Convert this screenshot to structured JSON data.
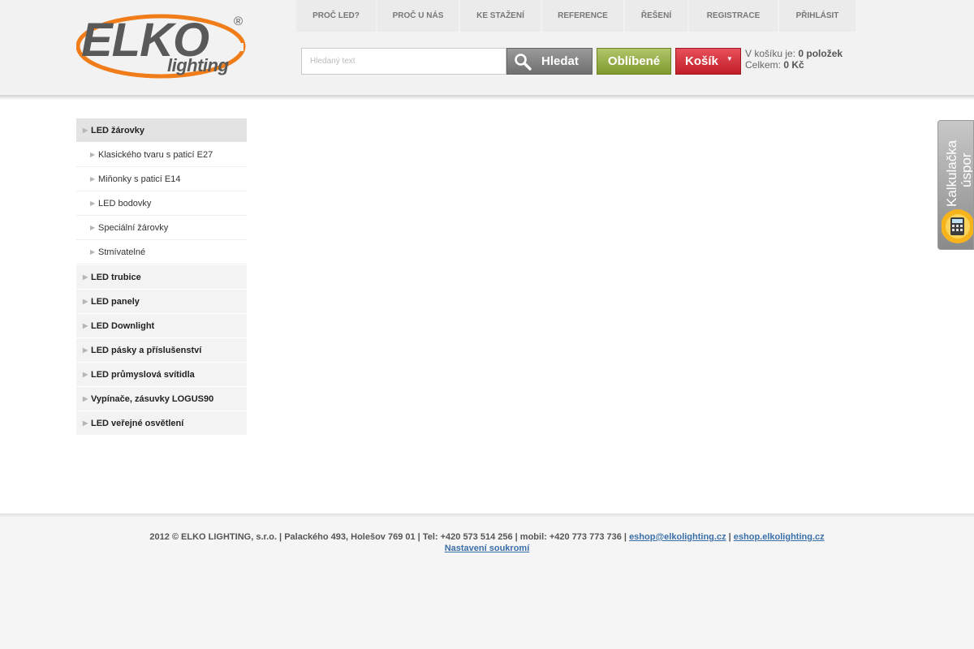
{
  "logo": {
    "main": "ELKO",
    "sub": "lighting",
    "reg": "®"
  },
  "topnav": [
    {
      "label": "PROČ LED?"
    },
    {
      "label": "PROČ U NÁS"
    },
    {
      "label": "KE STAŽENÍ"
    },
    {
      "label": "REFERENCE"
    },
    {
      "label": "ŘEŠENÍ"
    },
    {
      "label": "REGISTRACE"
    },
    {
      "label": "PŘIHLÁSIT"
    }
  ],
  "search": {
    "placeholder": "Hledaný text",
    "button_label": "Hledat"
  },
  "favorites": {
    "label": "Oblíbené"
  },
  "cart": {
    "label": "Košík",
    "count_prefix": "V košíku je:",
    "count_value": "0 položek",
    "total_prefix": "Celkem:",
    "total_value": "0 Kč"
  },
  "sidebar": {
    "active_category": "LED žárovky",
    "subitems": [
      "Klasického tvaru s paticí E27",
      "Miňonky s paticí E14",
      "LED bodovky",
      "Speciální žárovky",
      "Stmívatelné"
    ],
    "categories": [
      "LED trubice",
      "LED panely",
      "LED Downlight",
      "LED pásky a příslušenství",
      "LED průmyslová svítidla",
      "Vypínače, zásuvky LOGUS90",
      "LED veřejné osvětlení"
    ]
  },
  "calc_tab": {
    "line1": "Kalkulačka",
    "line2": "úspor"
  },
  "footer": {
    "text": "2012 © ELKO LIGHTING, s.r.o. | Palackého 493, Holešov 769 01 | Tel: +420 573 514 256 | mobil: +420 773 773 736 |",
    "email": "eshop@elkolighting.cz",
    "separator": "|",
    "site": "eshop.elkolighting.cz",
    "privacy": "Nastavení soukromí"
  },
  "colors": {
    "search_button": "#7f7f7f",
    "favorites_button": "#8fa83a",
    "cart_button": "#d22a33",
    "logo_orange": "#f07d1a",
    "link": "#3a6fa8"
  },
  "icons": {
    "search": "magnifier-icon",
    "cart_dropdown": "caret-down-icon",
    "calc": "calculator-icon",
    "bullet": "caret-right-icon"
  }
}
